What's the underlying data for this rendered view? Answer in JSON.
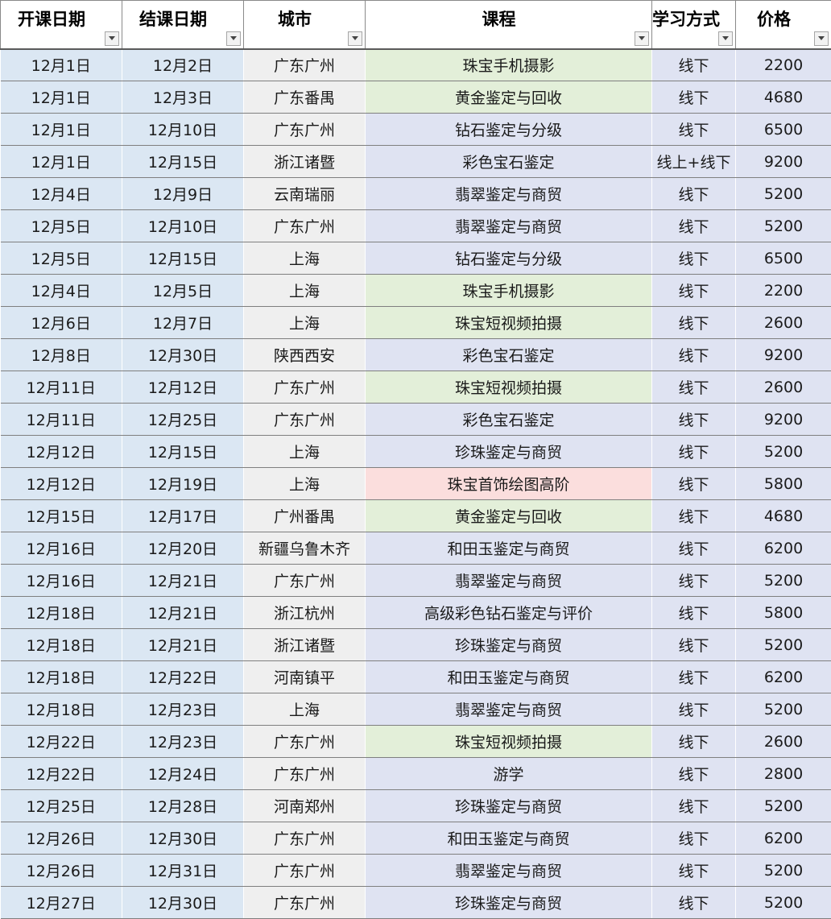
{
  "headers": [
    "开课日期",
    "结课日期",
    "城市",
    "课程",
    "学习方式",
    "价格"
  ],
  "colors": {
    "date_fill": "#dbe7f3",
    "city_fill": "#efefef",
    "course_green": "#e3efd9",
    "course_blue": "#dfe3f2",
    "course_pink": "#fbdedd"
  },
  "rows": [
    {
      "start": "12月1日",
      "end": "12月2日",
      "city": "广东广州",
      "course": "珠宝手机摄影",
      "mode": "线下",
      "price": "2200",
      "tag": "green"
    },
    {
      "start": "12月1日",
      "end": "12月3日",
      "city": "广东番禺",
      "course": "黄金鉴定与回收",
      "mode": "线下",
      "price": "4680",
      "tag": "green"
    },
    {
      "start": "12月1日",
      "end": "12月10日",
      "city": "广东广州",
      "course": "钻石鉴定与分级",
      "mode": "线下",
      "price": "6500",
      "tag": "blue"
    },
    {
      "start": "12月1日",
      "end": "12月15日",
      "city": "浙江诸暨",
      "course": "彩色宝石鉴定",
      "mode": "线上+线下",
      "price": "9200",
      "tag": "blue"
    },
    {
      "start": "12月4日",
      "end": "12月9日",
      "city": "云南瑞丽",
      "course": "翡翠鉴定与商贸",
      "mode": "线下",
      "price": "5200",
      "tag": "blue"
    },
    {
      "start": "12月5日",
      "end": "12月10日",
      "city": "广东广州",
      "course": "翡翠鉴定与商贸",
      "mode": "线下",
      "price": "5200",
      "tag": "blue"
    },
    {
      "start": "12月5日",
      "end": "12月15日",
      "city": "上海",
      "course": "钻石鉴定与分级",
      "mode": "线下",
      "price": "6500",
      "tag": "blue"
    },
    {
      "start": "12月4日",
      "end": "12月5日",
      "city": "上海",
      "course": "珠宝手机摄影",
      "mode": "线下",
      "price": "2200",
      "tag": "green"
    },
    {
      "start": "12月6日",
      "end": "12月7日",
      "city": "上海",
      "course": "珠宝短视频拍摄",
      "mode": "线下",
      "price": "2600",
      "tag": "green"
    },
    {
      "start": "12月8日",
      "end": "12月30日",
      "city": "陕西西安",
      "course": "彩色宝石鉴定",
      "mode": "线下",
      "price": "9200",
      "tag": "blue"
    },
    {
      "start": "12月11日",
      "end": "12月12日",
      "city": "广东广州",
      "course": "珠宝短视频拍摄",
      "mode": "线下",
      "price": "2600",
      "tag": "green"
    },
    {
      "start": "12月11日",
      "end": "12月25日",
      "city": "广东广州",
      "course": "彩色宝石鉴定",
      "mode": "线下",
      "price": "9200",
      "tag": "blue"
    },
    {
      "start": "12月12日",
      "end": "12月15日",
      "city": "上海",
      "course": "珍珠鉴定与商贸",
      "mode": "线下",
      "price": "5200",
      "tag": "blue"
    },
    {
      "start": "12月12日",
      "end": "12月19日",
      "city": "上海",
      "course": "珠宝首饰绘图高阶",
      "mode": "线下",
      "price": "5800",
      "tag": "pink"
    },
    {
      "start": "12月15日",
      "end": "12月17日",
      "city": "广州番禺",
      "course": "黄金鉴定与回收",
      "mode": "线下",
      "price": "4680",
      "tag": "green"
    },
    {
      "start": "12月16日",
      "end": "12月20日",
      "city": "新疆乌鲁木齐",
      "course": "和田玉鉴定与商贸",
      "mode": "线下",
      "price": "6200",
      "tag": "blue"
    },
    {
      "start": "12月16日",
      "end": "12月21日",
      "city": "广东广州",
      "course": "翡翠鉴定与商贸",
      "mode": "线下",
      "price": "5200",
      "tag": "blue"
    },
    {
      "start": "12月18日",
      "end": "12月21日",
      "city": "浙江杭州",
      "course": "高级彩色钻石鉴定与评价",
      "mode": "线下",
      "price": "5800",
      "tag": "blue"
    },
    {
      "start": "12月18日",
      "end": "12月21日",
      "city": "浙江诸暨",
      "course": "珍珠鉴定与商贸",
      "mode": "线下",
      "price": "5200",
      "tag": "blue"
    },
    {
      "start": "12月18日",
      "end": "12月22日",
      "city": "河南镇平",
      "course": "和田玉鉴定与商贸",
      "mode": "线下",
      "price": "6200",
      "tag": "blue"
    },
    {
      "start": "12月18日",
      "end": "12月23日",
      "city": "上海",
      "course": "翡翠鉴定与商贸",
      "mode": "线下",
      "price": "5200",
      "tag": "blue"
    },
    {
      "start": "12月22日",
      "end": "12月23日",
      "city": "广东广州",
      "course": "珠宝短视频拍摄",
      "mode": "线下",
      "price": "2600",
      "tag": "green"
    },
    {
      "start": "12月22日",
      "end": "12月24日",
      "city": "广东广州",
      "course": "游学",
      "mode": "线下",
      "price": "2800",
      "tag": "blue"
    },
    {
      "start": "12月25日",
      "end": "12月28日",
      "city": "河南郑州",
      "course": "珍珠鉴定与商贸",
      "mode": "线下",
      "price": "5200",
      "tag": "blue"
    },
    {
      "start": "12月26日",
      "end": "12月30日",
      "city": "广东广州",
      "course": "和田玉鉴定与商贸",
      "mode": "线下",
      "price": "6200",
      "tag": "blue"
    },
    {
      "start": "12月26日",
      "end": "12月31日",
      "city": "广东广州",
      "course": "翡翠鉴定与商贸",
      "mode": "线下",
      "price": "5200",
      "tag": "blue"
    },
    {
      "start": "12月27日",
      "end": "12月30日",
      "city": "广东广州",
      "course": "珍珠鉴定与商贸",
      "mode": "线下",
      "price": "5200",
      "tag": "blue"
    }
  ]
}
